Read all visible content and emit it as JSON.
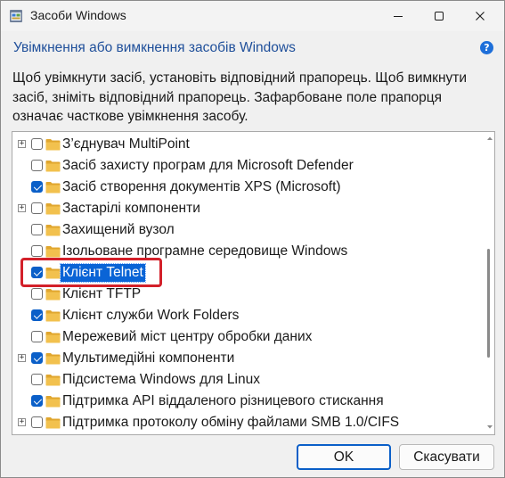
{
  "window": {
    "title": "Засоби Windows",
    "minimize_icon": "minimize-icon",
    "maximize_icon": "maximize-icon",
    "close_icon": "close-icon"
  },
  "heading": "Увімкнення або вимкнення засобів Windows",
  "help_glyph": "?",
  "description": "Щоб увімкнути засіб, установіть відповідний прапорець. Щоб вимкнути засіб, зніміть відповідний прапорець. Зафарбоване поле прапорця означає часткове увімкнення засобу.",
  "features": [
    {
      "label": "З’єднувач MultiPoint",
      "expandable": true,
      "checked": false
    },
    {
      "label": "Засіб захисту програм для Microsoft Defender",
      "expandable": false,
      "checked": false
    },
    {
      "label": "Засіб створення документів XPS (Microsoft)",
      "expandable": false,
      "checked": true
    },
    {
      "label": "Застарілі компоненти",
      "expandable": true,
      "checked": false
    },
    {
      "label": "Захищений вузол",
      "expandable": false,
      "checked": false
    },
    {
      "label": "Ізольоване програмне середовище Windows",
      "expandable": false,
      "checked": false
    },
    {
      "label": "Клієнт Telnet",
      "expandable": false,
      "checked": true,
      "selected": true
    },
    {
      "label": "Клієнт TFTP",
      "expandable": false,
      "checked": false
    },
    {
      "label": "Клієнт служби Work Folders",
      "expandable": false,
      "checked": true
    },
    {
      "label": "Мережевий міст центру обробки даних",
      "expandable": false,
      "checked": false
    },
    {
      "label": "Мультимедійні компоненти",
      "expandable": true,
      "checked": true
    },
    {
      "label": "Підсистема Windows для Linux",
      "expandable": false,
      "checked": false
    },
    {
      "label": "Підтримка API віддаленого різницевого стискання",
      "expandable": false,
      "checked": true
    },
    {
      "label": "Підтримка протоколу обміну файлами SMB 1.0/CIFS",
      "expandable": true,
      "checked": false
    }
  ],
  "expander_glyph": "+",
  "buttons": {
    "ok": "OK",
    "cancel": "Скасувати"
  },
  "colors": {
    "accent": "#0a5fc8",
    "heading": "#1f4f9a",
    "highlight": "#d3202a",
    "folder": "#f2c14e"
  }
}
